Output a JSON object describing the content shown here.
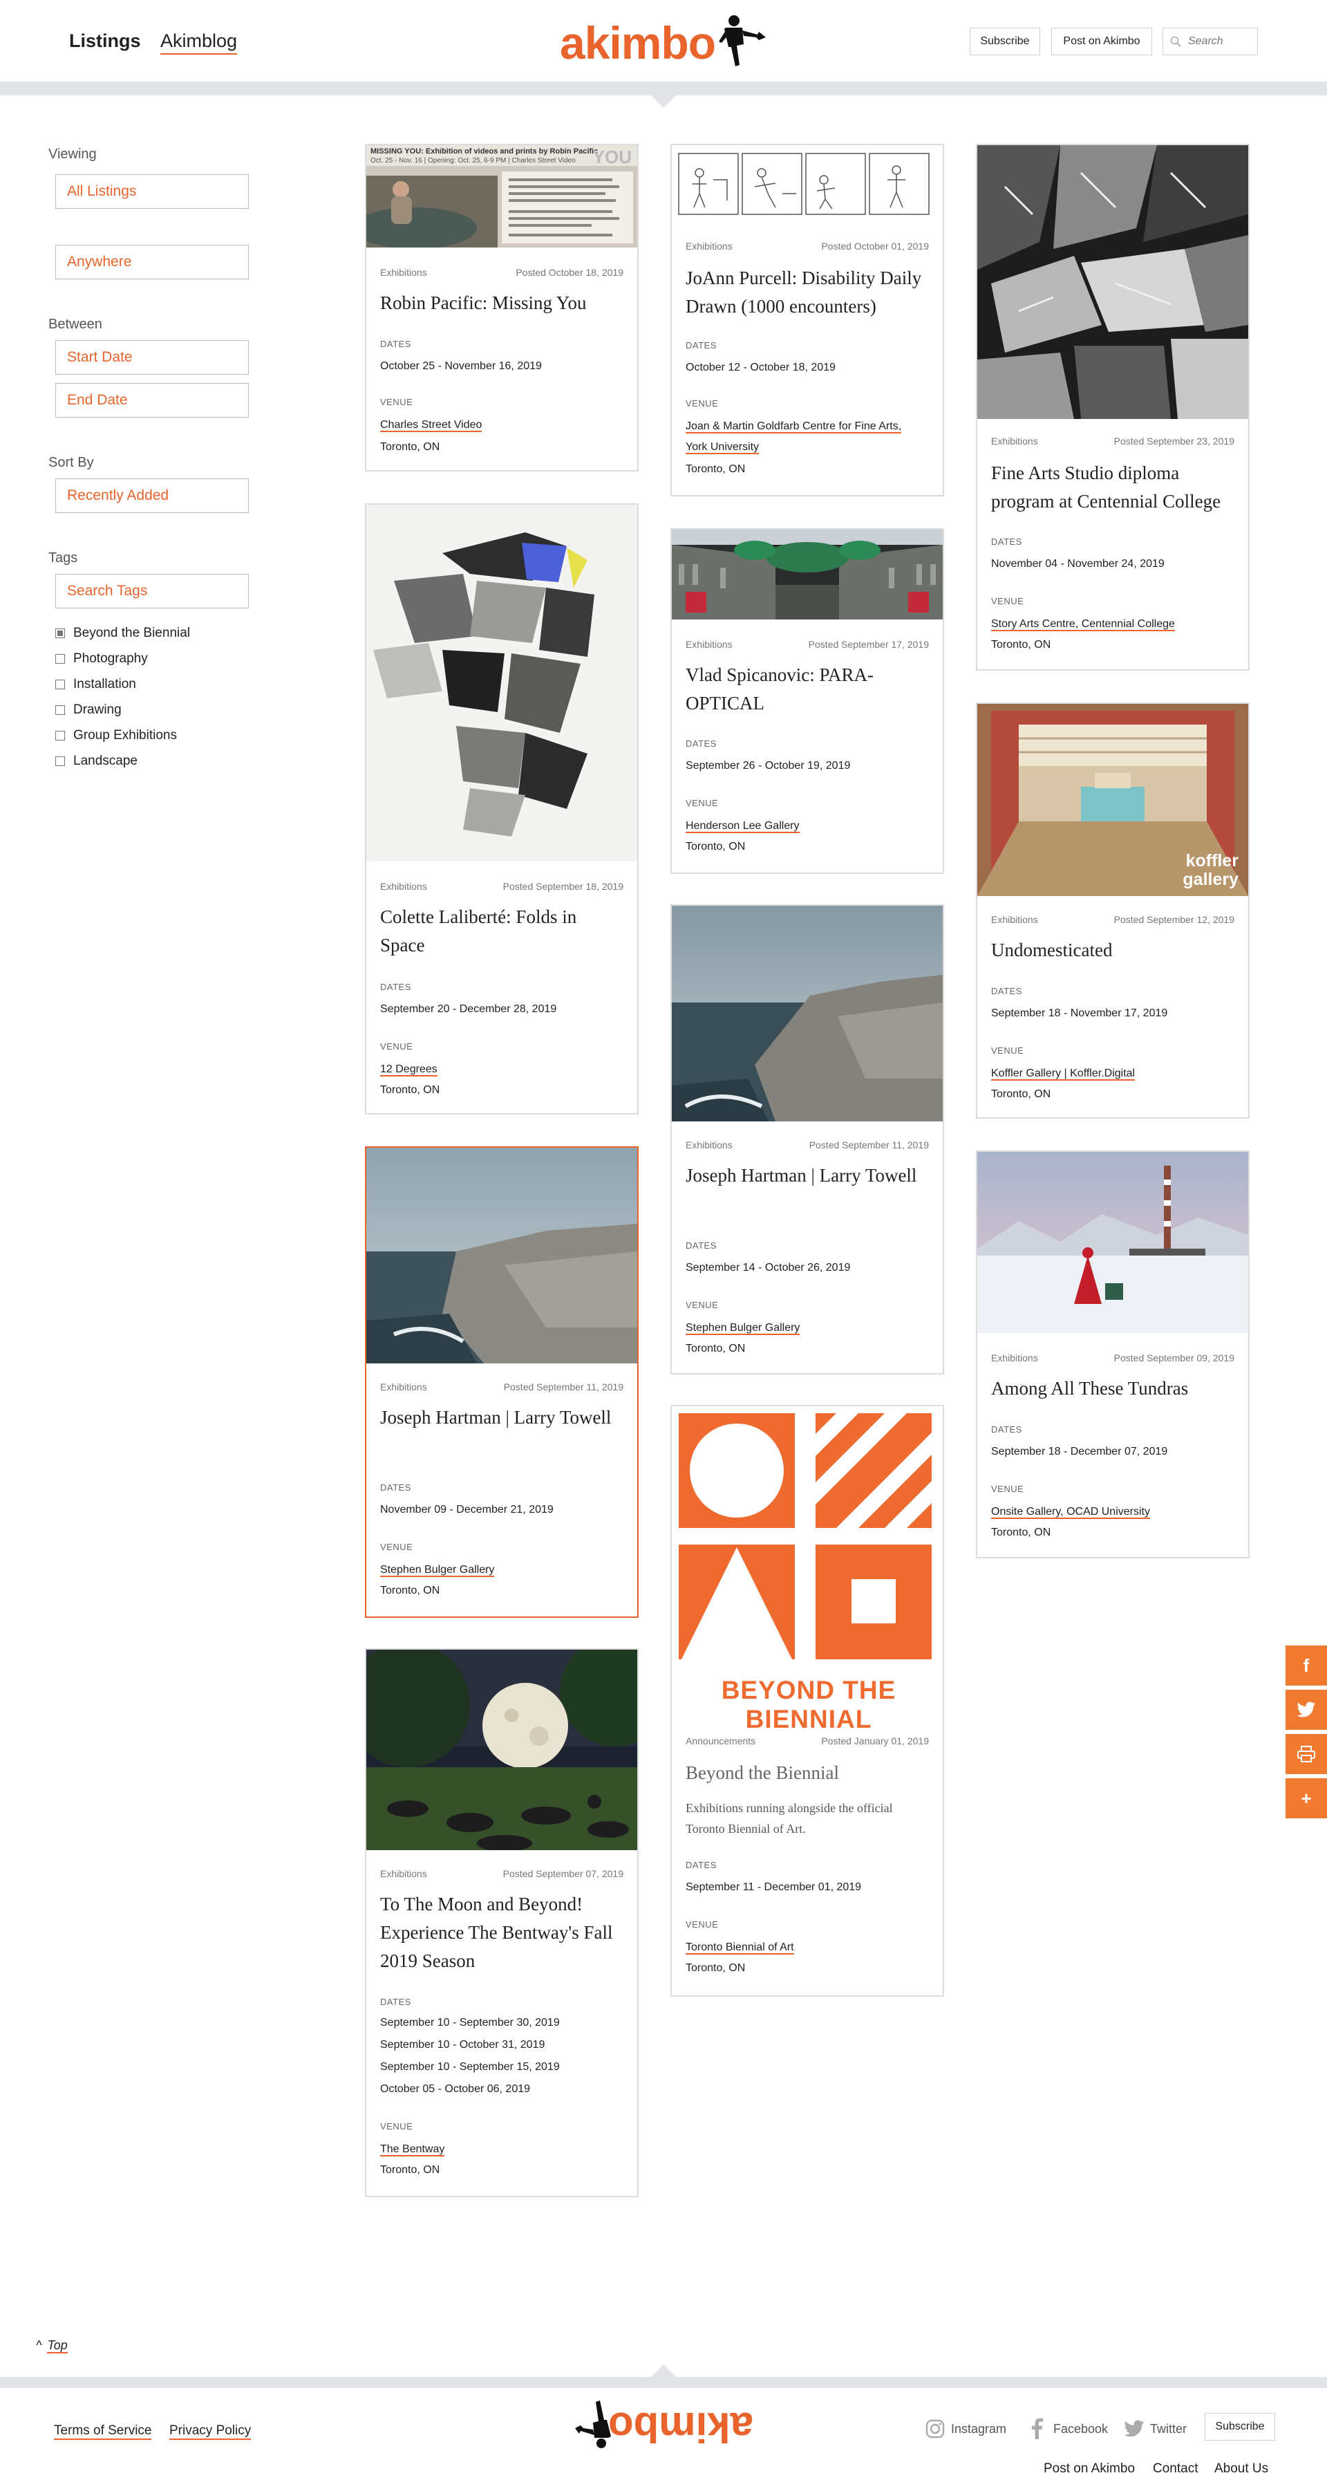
{
  "header": {
    "nav": {
      "listings": "Listings",
      "akimblog": "Akimblog"
    },
    "logo": "akimbo",
    "subscribe": "Subscribe",
    "post": "Post on Akimbo",
    "search_placeholder": "Search"
  },
  "sidebar": {
    "viewing_label": "Viewing",
    "viewing_value": "All Listings",
    "location_value": "Anywhere",
    "between_label": "Between",
    "start_date": "Start Date",
    "end_date": "End Date",
    "sort_label": "Sort By",
    "sort_value": "Recently Added",
    "tags_label": "Tags",
    "tags_placeholder": "Search Tags",
    "tags": [
      {
        "label": "Beyond the Biennial",
        "checked": true
      },
      {
        "label": "Photography",
        "checked": false
      },
      {
        "label": "Installation",
        "checked": false
      },
      {
        "label": "Drawing",
        "checked": false
      },
      {
        "label": "Group Exhibitions",
        "checked": false
      },
      {
        "label": "Landscape",
        "checked": false
      }
    ]
  },
  "labels": {
    "dates": "DATES",
    "venue": "VENUE"
  },
  "cards": {
    "robin": {
      "category": "Exhibitions",
      "posted": "Posted October 18, 2019",
      "title": "Robin Pacific: Missing You",
      "dates": "October 25 - November 16, 2019",
      "venue": "Charles Street Video",
      "city": "Toronto, ON",
      "img_caption": "MISSING YOU: Exhibition of videos and prints by Robin Pacific",
      "img_sub": "Oct. 25 - Nov. 16 | Opening: Oct. 25, 6-9 PM | Charles Street Video",
      "img_word": "YOU"
    },
    "colette": {
      "category": "Exhibitions",
      "posted": "Posted September 18, 2019",
      "title": "Colette Laliberté: Folds in Space",
      "dates": "September 20 - December 28, 2019",
      "venue": "12 Degrees",
      "city": "Toronto, ON"
    },
    "hartman_nov": {
      "category": "Exhibitions",
      "posted": "Posted September 11, 2019",
      "title": "Joseph Hartman | Larry Towell",
      "dates": "November 09 - December 21, 2019",
      "venue": "Stephen Bulger Gallery",
      "city": "Toronto, ON"
    },
    "moon": {
      "category": "Exhibitions",
      "posted": "Posted September 07, 2019",
      "title": "To The Moon and Beyond! Experience The Bentway's Fall 2019 Season",
      "dates": [
        "September 10 - September 30, 2019",
        "September 10 - October 31, 2019",
        "September 10 - September 15, 2019",
        "October 05 - October 06, 2019"
      ],
      "venue": "The Bentway",
      "city": "Toronto, ON"
    },
    "joann": {
      "category": "Exhibitions",
      "posted": "Posted October 01, 2019",
      "title": "JoAnn Purcell: Disability Daily Drawn (1000 encounters)",
      "dates": "October 12 - October 18, 2019",
      "venue_line1": "Joan & Martin Goldfarb Centre for Fine Arts,",
      "venue_line2": "York University",
      "city": "Toronto, ON"
    },
    "vlad": {
      "category": "Exhibitions",
      "posted": "Posted September 17, 2019",
      "title": "Vlad Spicanovic: PARA-OPTICAL",
      "dates": "September 26 - October 19, 2019",
      "venue": "Henderson Lee Gallery",
      "city": "Toronto, ON"
    },
    "hartman_sep": {
      "category": "Exhibitions",
      "posted": "Posted September 11, 2019",
      "title": "Joseph Hartman | Larry Towell",
      "dates": "September 14 - October 26, 2019",
      "venue": "Stephen Bulger Gallery",
      "city": "Toronto, ON"
    },
    "biennial": {
      "category": "Announcements",
      "posted": "Posted January 01, 2019",
      "title": "Beyond the Biennial",
      "desc": "Exhibitions running alongside the official Toronto Biennial of Art.",
      "dates": "September 11 - December 01, 2019",
      "venue": "Toronto Biennial of Art",
      "city": "Toronto, ON",
      "img_text": "BEYOND THE BIENNIAL"
    },
    "finearts": {
      "category": "Exhibitions",
      "posted": "Posted September 23, 2019",
      "title": "Fine Arts Studio diploma program at Centennial College",
      "dates": "November 04 - November 24, 2019",
      "venue": "Story Arts Centre, Centennial College",
      "city": "Toronto, ON"
    },
    "undomesticated": {
      "category": "Exhibitions",
      "posted": "Posted September 12, 2019",
      "title": "Undomesticated",
      "dates": "September 18 - November 17, 2019",
      "venue": "Koffler Gallery | Koffler.Digital",
      "city": "Toronto, ON",
      "img_text": "koffler gallery"
    },
    "tundras": {
      "category": "Exhibitions",
      "posted": "Posted September 09, 2019",
      "title": "Among All These Tundras",
      "dates": "September 18 - December 07, 2019",
      "venue": "Onsite Gallery, OCAD University",
      "city": "Toronto, ON"
    }
  },
  "share": {
    "facebook": "f",
    "twitter": "twitter-icon",
    "print": "print-icon",
    "more": "+"
  },
  "footer": {
    "top": "Top",
    "terms": "Terms of Service",
    "privacy": "Privacy Policy",
    "instagram": "Instagram",
    "facebook": "Facebook",
    "twitter": "Twitter",
    "subscribe": "Subscribe",
    "post": "Post on Akimbo",
    "contact": "Contact",
    "about": "About Us"
  },
  "colors": {
    "accent": "#e8642c",
    "share": "#f07a30",
    "band": "#e2e4e7"
  }
}
